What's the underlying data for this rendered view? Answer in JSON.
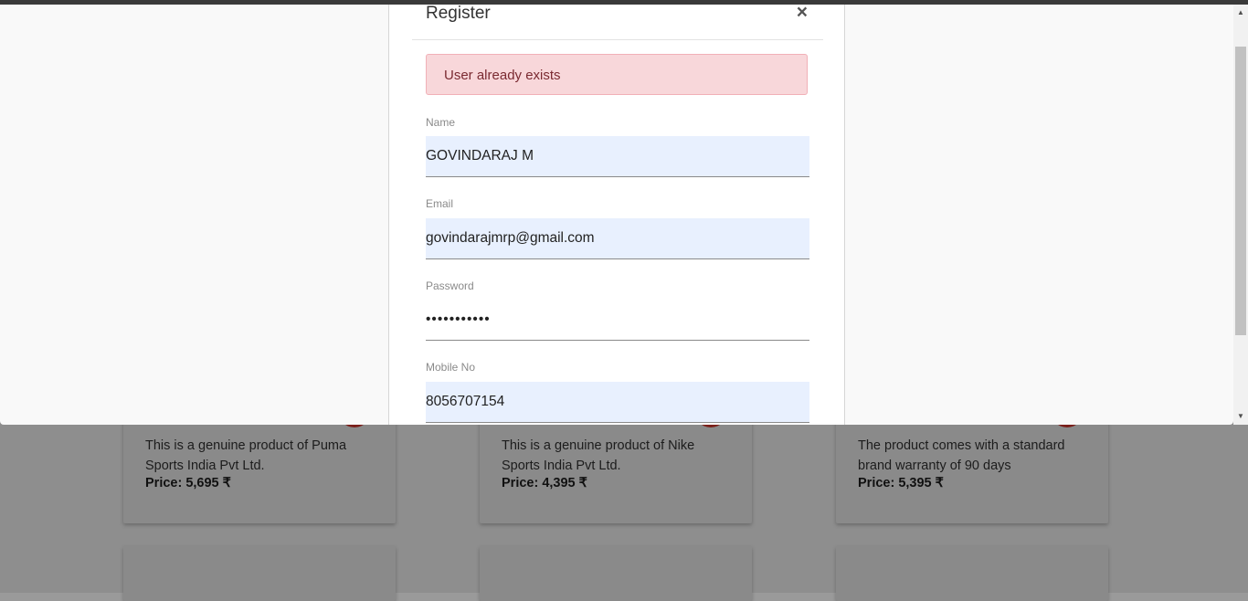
{
  "modal": {
    "title": "Register",
    "close_symbol": "×",
    "alert_message": "User already exists"
  },
  "form": {
    "name_label": "Name",
    "name_value": "GOVINDARAJ M",
    "email_label": "Email",
    "email_value": "govindarajmrp@gmail.com",
    "password_label": "Password",
    "password_value": "•••••••••••",
    "mobile_label": "Mobile No",
    "mobile_value": "8056707154"
  },
  "products": [
    {
      "description": "This is a genuine product of Puma Sports India Pvt Ltd.",
      "price": "Price: 5,695 ₹"
    },
    {
      "description": "This is a genuine product of Nike Sports India Pvt Ltd.",
      "price": "Price: 4,395 ₹"
    },
    {
      "description": "The product comes with a standard brand warranty of 90 days",
      "price": "Price: 5,395 ₹"
    }
  ],
  "colors": {
    "alert_bg": "#f8d7da",
    "alert_text": "#7a2a31",
    "autofill_bg": "#e8f0fe",
    "fab_red": "#c62828"
  },
  "icons": {
    "close": "close-icon",
    "scroll_up": "scroll-up-arrow",
    "scroll_down": "scroll-down-arrow"
  }
}
